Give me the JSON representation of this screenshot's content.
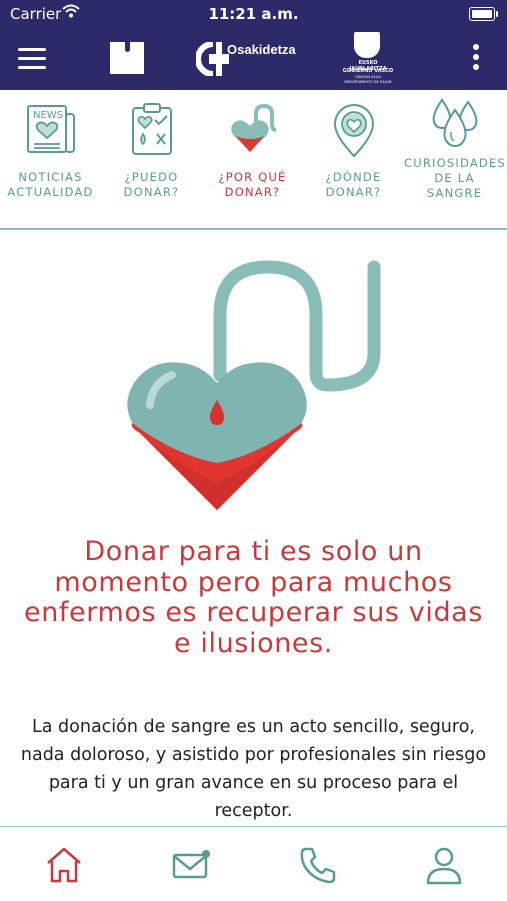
{
  "status_bar": {
    "carrier": "Carrier",
    "time": "11:21 a.m."
  },
  "header": {
    "brand": "Osakidetza",
    "gov_line1": "EUSKO JAURLARITZA",
    "gov_line2": "GOBIERNO VASCO",
    "gov_line3": "OSASUN SAILA",
    "gov_line4": "DEPARTAMENTO DE SALUD"
  },
  "categories": [
    {
      "label": "NOTICIAS\nACTUALIDAD",
      "icon": "newspaper-icon",
      "active": false
    },
    {
      "label": "¿PUEDO\nDONAR?",
      "icon": "checklist-icon",
      "active": false
    },
    {
      "label": "¿POR QUÉ\nDONAR?",
      "icon": "heart-tube-icon",
      "active": true
    },
    {
      "label": "¿DÓNDE\nDONAR?",
      "icon": "location-pin-icon",
      "active": false
    },
    {
      "label": "CURIOSIDADES\nDE LA\nSANGRE",
      "icon": "blood-drops-icon",
      "active": false
    }
  ],
  "main": {
    "headline": "Donar para ti es solo un momento pero para muchos enfermos es recuperar sus vidas e ilusiones.",
    "body": "La donación de sangre es un acto sencillo, seguro, nada doloroso, y asistido por profesionales sin riesgo para ti y un gran avance en su proceso para el receptor."
  },
  "colors": {
    "header_bg": "#2d2a69",
    "teal": "#5a9a96",
    "accent_red": "#c73a3c"
  },
  "tabbar": [
    {
      "icon": "home-icon",
      "active": true
    },
    {
      "icon": "mail-icon",
      "active": false
    },
    {
      "icon": "phone-icon",
      "active": false
    },
    {
      "icon": "user-icon",
      "active": false
    }
  ]
}
